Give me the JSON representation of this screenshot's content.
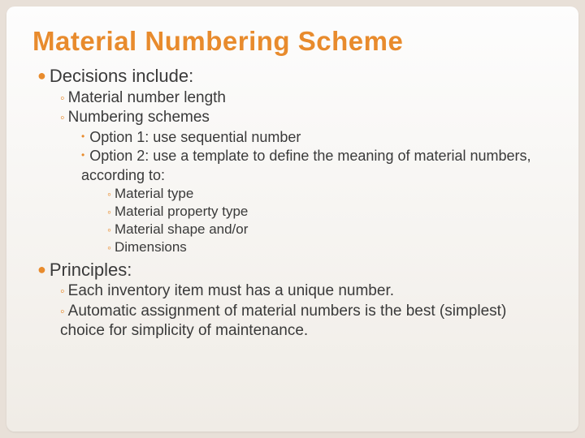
{
  "title": "Material Numbering Scheme",
  "sections": [
    {
      "label": "Decisions include:",
      "items": [
        {
          "label": "Material number length"
        },
        {
          "label": "Numbering schemes",
          "items": [
            {
              "label": "Option 1: use sequential number"
            },
            {
              "label": "Option 2: use a template to define the meaning of material numbers, according to:",
              "items": [
                {
                  "label": "Material type"
                },
                {
                  "label": "Material property type"
                },
                {
                  "label": "Material shape and/or"
                },
                {
                  "label": "Dimensions"
                }
              ]
            }
          ]
        }
      ]
    },
    {
      "label": "Principles:",
      "items": [
        {
          "label": "Each inventory item must has a unique number."
        },
        {
          "label": "Automatic assignment of material numbers is the best (simplest) choice for simplicity of maintenance."
        }
      ]
    }
  ]
}
